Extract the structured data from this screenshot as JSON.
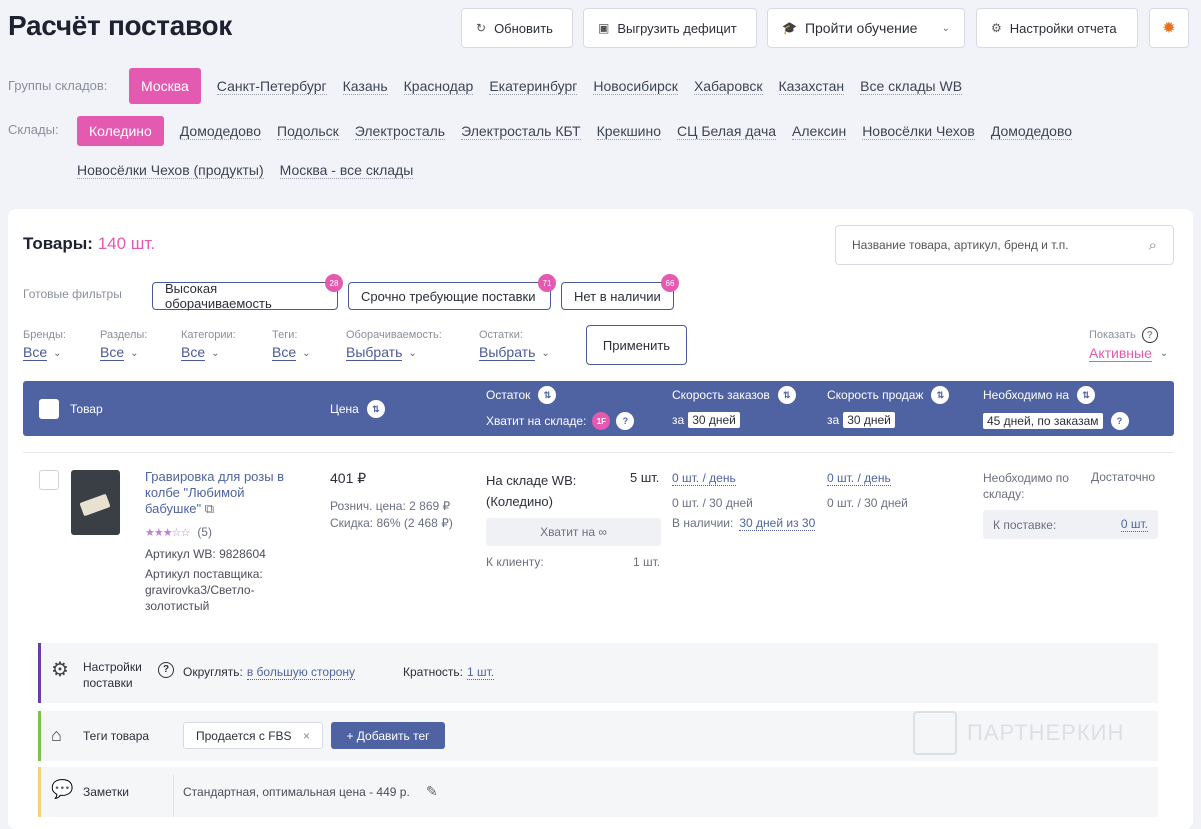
{
  "page_title": "Расчёт поставок",
  "toolbar": {
    "refresh": "Обновить",
    "export_deficit": "Выгрузить дефицит",
    "training": "Пройти обучение",
    "report_settings": "Настройки отчета"
  },
  "warehouse_groups": {
    "label": "Группы складов:",
    "active": "Москва",
    "items": [
      "Санкт-Петербург",
      "Казань",
      "Краснодар",
      "Екатеринбург",
      "Новосибирск",
      "Хабаровск",
      "Казахстан",
      "Все склады WB"
    ]
  },
  "warehouses": {
    "label": "Склады:",
    "active": "Коледино",
    "row1": [
      "Домодедово",
      "Подольск",
      "Электросталь",
      "Электросталь КБТ",
      "Крекшино",
      "СЦ Белая дача",
      "Алексин",
      "Новосёлки Чехов",
      "Домодедово"
    ],
    "row2": [
      "Новосёлки Чехов (продукты)",
      "Москва - все склады"
    ]
  },
  "products": {
    "title": "Товары:",
    "count": "140 шт.",
    "search_placeholder": "Название товара, артикул, бренд и т.п."
  },
  "ready_filters": {
    "label": "Готовые фильтры",
    "items": [
      {
        "label": "Высокая оборачиваемость",
        "badge": "28"
      },
      {
        "label": "Срочно требующие поставки",
        "badge": "71"
      },
      {
        "label": "Нет в наличии",
        "badge": "66"
      }
    ]
  },
  "filters": {
    "brands": {
      "label": "Бренды:",
      "value": "Все"
    },
    "sections": {
      "label": "Разделы:",
      "value": "Все"
    },
    "categories": {
      "label": "Категории:",
      "value": "Все"
    },
    "tags": {
      "label": "Теги:",
      "value": "Все"
    },
    "turnover": {
      "label": "Оборачиваемость:",
      "value": "Выбрать"
    },
    "stock": {
      "label": "Остатки:",
      "value": "Выбрать"
    },
    "apply": "Применить",
    "show_label": "Показать",
    "show_value": "Активные"
  },
  "table_header": {
    "product": "Товар",
    "price": "Цена",
    "stock": "Остаток",
    "enough": "Хватит на складе:",
    "enough_badge": "1F",
    "order_speed": "Скорость заказов",
    "order_period_prefix": "за",
    "order_period": "30 дней",
    "sales_speed": "Скорость продаж",
    "sales_period_prefix": "за",
    "sales_period": "30 дней",
    "needed": "Необходимо на",
    "needed_value": "45 дней, по заказам"
  },
  "row": {
    "name": "Гравировка для розы в колбе \"Любимой бабушке\"",
    "rating_count": "(5)",
    "rating": 3,
    "article_wb": "Артикул WB: 9828604",
    "article_supplier_label": "Артикул поставщика:",
    "article_supplier": "gravirovka3/Светло-золотистый",
    "price": "401 ₽",
    "retail_price": "Рознич. цена: 2 869 ₽",
    "discount": "Скидка: 86% (2 468 ₽)",
    "wb_stock_label": "На складе WB:",
    "wb_stock_wh": "(Коледино)",
    "wb_stock_value": "5 шт.",
    "enough_box": "Хватит на ∞",
    "to_client_label": "К клиенту:",
    "to_client_value": "1 шт.",
    "orders_day": "0 шт. / день",
    "orders_30": "0 шт. / 30 дней",
    "in_stock_label": "В наличии:",
    "in_stock_value": "30 дней из 30",
    "sales_day": "0 шт. / день",
    "sales_30": "0 шт. / 30 дней",
    "need_by_wh": "Необходимо по складу:",
    "enough_status": "Достаточно",
    "to_supply_label": "К поставке:",
    "to_supply_value": "0 шт."
  },
  "supply_settings": {
    "label": "Настройки поставки",
    "round_label": "Округлять:",
    "round_value": "в большую сторону",
    "mult_label": "Кратность:",
    "mult_value": "1 шт."
  },
  "tags_panel": {
    "label": "Теги товара",
    "tag": "Продается с FBS",
    "add": "+ Добавить тег"
  },
  "notes_panel": {
    "label": "Заметки",
    "text": "Стандартная, оптимальная цена - 449 р."
  },
  "watermark": "ПАРТНЕРКИН",
  "colors": {
    "accent": "#e45ab0",
    "header": "#4f63a3"
  }
}
